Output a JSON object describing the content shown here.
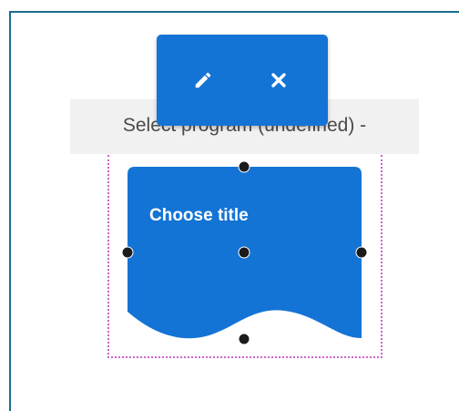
{
  "canvas": {
    "label_text": "Select program (undefined) -"
  },
  "shape": {
    "type": "document-shape",
    "title": "Choose title",
    "fill_color": "#1474d5",
    "selection_border_color": "#cf63c9"
  },
  "toolbar": {
    "background_color": "#1474d5",
    "buttons": [
      {
        "name": "edit",
        "icon": "pencil-icon"
      },
      {
        "name": "remove",
        "icon": "close-icon"
      }
    ]
  },
  "handles": [
    "top",
    "left",
    "center",
    "right",
    "bottom"
  ]
}
